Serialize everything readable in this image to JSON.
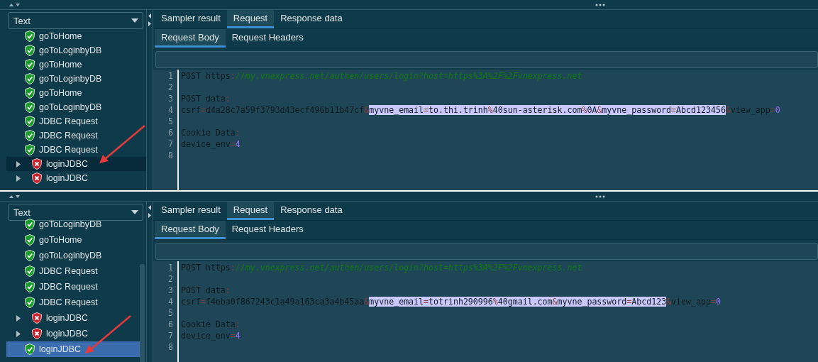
{
  "panels": [
    {
      "view_select": {
        "value": "Text"
      },
      "tree": [
        {
          "label": "goToHome",
          "kind": "passed",
          "expandable": false,
          "selected": false
        },
        {
          "label": "goToLoginbyDB",
          "kind": "passed",
          "expandable": false,
          "selected": false
        },
        {
          "label": "goToHome",
          "kind": "passed",
          "expandable": false,
          "selected": false
        },
        {
          "label": "goToLoginbyDB",
          "kind": "passed",
          "expandable": false,
          "selected": false
        },
        {
          "label": "goToHome",
          "kind": "passed",
          "expandable": false,
          "selected": false
        },
        {
          "label": "goToLoginbyDB",
          "kind": "passed",
          "expandable": false,
          "selected": false
        },
        {
          "label": "JDBC Request",
          "kind": "passed",
          "expandable": false,
          "selected": false
        },
        {
          "label": "JDBC Request",
          "kind": "passed",
          "expandable": false,
          "selected": false
        },
        {
          "label": "JDBC Request",
          "kind": "passed",
          "expandable": false,
          "selected": false
        },
        {
          "label": "loginJDBC",
          "kind": "failed",
          "expandable": true,
          "selected": true
        },
        {
          "label": "loginJDBC",
          "kind": "failed",
          "expandable": true,
          "selected": false
        }
      ],
      "tabs": [
        {
          "label": "Sampler result",
          "selected": false
        },
        {
          "label": "Request",
          "selected": true
        },
        {
          "label": "Response data",
          "selected": false
        }
      ],
      "subtabs": [
        {
          "label": "Request Body",
          "selected": true
        },
        {
          "label": "Request Headers",
          "selected": false
        }
      ],
      "code": [
        {
          "number": "1",
          "segments": [
            {
              "text": "POST https",
              "kind": "plain",
              "selected": false
            },
            {
              "text": ":",
              "kind": "punct",
              "selected": false
            },
            {
              "text": "//my.vnexpress.net/authen/users/login?host=https%3A%2F%2Fvnexpress.net",
              "kind": "url",
              "selected": false
            }
          ]
        },
        {
          "number": "2"
        },
        {
          "number": "3",
          "segments": [
            {
              "text": "POST data",
              "kind": "plain",
              "selected": false
            },
            {
              "text": ":",
              "kind": "punct",
              "selected": false
            }
          ]
        },
        {
          "number": "4",
          "segments": [
            {
              "text": "csrf",
              "kind": "plain",
              "selected": false
            },
            {
              "text": "=",
              "kind": "punct",
              "selected": false
            },
            {
              "text": "d4a28c7a59f3793d43ecf496b11b47cf",
              "kind": "plain",
              "selected": false
            },
            {
              "text": "&",
              "kind": "punct",
              "selected": false
            },
            {
              "text": "myvne_email",
              "kind": "plain",
              "selected": true
            },
            {
              "text": "=",
              "kind": "punct",
              "selected": true
            },
            {
              "text": "to.thi.trinh",
              "kind": "plain",
              "selected": true
            },
            {
              "text": "%",
              "kind": "punct",
              "selected": true
            },
            {
              "text": "40sun-asterisk.com",
              "kind": "plain",
              "selected": true
            },
            {
              "text": "%",
              "kind": "punct",
              "selected": true
            },
            {
              "text": "0A",
              "kind": "plain",
              "selected": true
            },
            {
              "text": "&",
              "kind": "punct",
              "selected": true
            },
            {
              "text": "myvne_password",
              "kind": "plain",
              "selected": true
            },
            {
              "text": "=",
              "kind": "punct",
              "selected": true
            },
            {
              "text": "Abcd123456",
              "kind": "plain",
              "selected": true
            },
            {
              "text": "&",
              "kind": "punct",
              "selected": false
            },
            {
              "text": "view_app",
              "kind": "plain",
              "selected": false
            },
            {
              "text": "=",
              "kind": "punct",
              "selected": false
            },
            {
              "text": "0",
              "kind": "number",
              "selected": false
            }
          ]
        },
        {
          "number": "5"
        },
        {
          "number": "6",
          "segments": [
            {
              "text": "Cookie Data",
              "kind": "plain",
              "selected": false
            },
            {
              "text": ":",
              "kind": "punct",
              "selected": false
            }
          ]
        },
        {
          "number": "7",
          "segments": [
            {
              "text": "device_env",
              "kind": "plain",
              "selected": false
            },
            {
              "text": "=",
              "kind": "punct",
              "selected": false
            },
            {
              "text": "4",
              "kind": "number",
              "selected": false
            }
          ]
        },
        {
          "number": "8"
        }
      ]
    },
    {
      "view_select": {
        "value": "Text"
      },
      "tree": [
        {
          "label": "goToLoginbyDB",
          "kind": "passed",
          "expandable": false,
          "selected": false
        },
        {
          "label": "goToHome",
          "kind": "passed",
          "expandable": false,
          "selected": false
        },
        {
          "label": "goToLoginbyDB",
          "kind": "passed",
          "expandable": false,
          "selected": false
        },
        {
          "label": "JDBC Request",
          "kind": "passed",
          "expandable": false,
          "selected": false
        },
        {
          "label": "JDBC Request",
          "kind": "passed",
          "expandable": false,
          "selected": false
        },
        {
          "label": "JDBC Request",
          "kind": "passed",
          "expandable": false,
          "selected": false
        },
        {
          "label": "loginJDBC",
          "kind": "failed",
          "expandable": true,
          "selected": false
        },
        {
          "label": "loginJDBC",
          "kind": "failed",
          "expandable": true,
          "selected": false
        },
        {
          "label": "loginJDBC",
          "kind": "passed",
          "expandable": false,
          "selected": true
        }
      ],
      "tabs": [
        {
          "label": "Sampler result",
          "selected": false
        },
        {
          "label": "Request",
          "selected": true
        },
        {
          "label": "Response data",
          "selected": false
        }
      ],
      "subtabs": [
        {
          "label": "Request Body",
          "selected": true
        },
        {
          "label": "Request Headers",
          "selected": false
        }
      ],
      "code": [
        {
          "number": "1",
          "segments": [
            {
              "text": "POST https",
              "kind": "plain",
              "selected": false
            },
            {
              "text": ":",
              "kind": "punct",
              "selected": false
            },
            {
              "text": "//my.vnexpress.net/authen/users/login?host=https%3A%2F%2Fvnexpress.net",
              "kind": "url",
              "selected": false
            }
          ]
        },
        {
          "number": "2"
        },
        {
          "number": "3",
          "segments": [
            {
              "text": "POST data",
              "kind": "plain",
              "selected": false
            },
            {
              "text": ":",
              "kind": "punct",
              "selected": false
            }
          ]
        },
        {
          "number": "4",
          "segments": [
            {
              "text": "csrf",
              "kind": "plain",
              "selected": false
            },
            {
              "text": "=",
              "kind": "punct",
              "selected": false
            },
            {
              "text": "f4eba0f867243c1a49a163ca3a4b45aa",
              "kind": "plain",
              "selected": false
            },
            {
              "text": "&",
              "kind": "punct",
              "selected": false
            },
            {
              "text": "myvne_email",
              "kind": "plain",
              "selected": true
            },
            {
              "text": "=",
              "kind": "punct",
              "selected": true
            },
            {
              "text": "totrinh290996",
              "kind": "plain",
              "selected": true
            },
            {
              "text": "%",
              "kind": "punct",
              "selected": true
            },
            {
              "text": "40gmail.com",
              "kind": "plain",
              "selected": true
            },
            {
              "text": "&",
              "kind": "punct",
              "selected": true
            },
            {
              "text": "myvne_password",
              "kind": "plain",
              "selected": true
            },
            {
              "text": "=",
              "kind": "punct",
              "selected": true
            },
            {
              "text": "Abcd123",
              "kind": "plain",
              "selected": true
            },
            {
              "text": "&",
              "kind": "punct",
              "selected": false
            },
            {
              "text": "view_app",
              "kind": "plain",
              "selected": false
            },
            {
              "text": "=",
              "kind": "punct",
              "selected": false
            },
            {
              "text": "0",
              "kind": "number",
              "selected": false
            }
          ]
        },
        {
          "number": "5"
        },
        {
          "number": "6",
          "segments": [
            {
              "text": "Cookie Data",
              "kind": "plain",
              "selected": false
            },
            {
              "text": ":",
              "kind": "punct",
              "selected": false
            }
          ]
        },
        {
          "number": "7",
          "segments": [
            {
              "text": "device_env",
              "kind": "plain",
              "selected": false
            },
            {
              "text": "=",
              "kind": "punct",
              "selected": false
            },
            {
              "text": "4",
              "kind": "number",
              "selected": false
            }
          ]
        },
        {
          "number": "8"
        }
      ]
    }
  ]
}
